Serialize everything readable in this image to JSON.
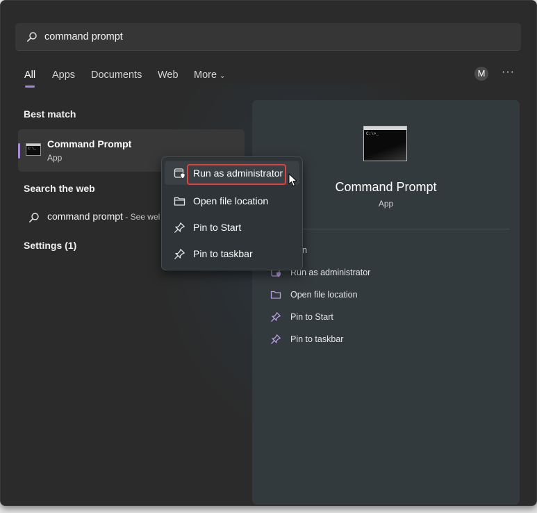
{
  "search": {
    "query": "command prompt"
  },
  "tabs": [
    {
      "label": "All",
      "active": true
    },
    {
      "label": "Apps"
    },
    {
      "label": "Documents"
    },
    {
      "label": "Web"
    },
    {
      "label": "More"
    }
  ],
  "header": {
    "avatar_initial": "M",
    "more_options": "···"
  },
  "sections": {
    "best_match": "Best match",
    "search_web": "Search the web",
    "settings": "Settings (1)"
  },
  "best_match_item": {
    "title": "Command Prompt",
    "subtitle": "App"
  },
  "web_result": {
    "query": "command prompt",
    "suffix": " - See wel"
  },
  "context_menu": {
    "items": [
      {
        "label": "Run as administrator",
        "icon": "shield-window-icon"
      },
      {
        "label": "Open file location",
        "icon": "folder-icon"
      },
      {
        "label": "Pin to Start",
        "icon": "pin-icon"
      },
      {
        "label": "Pin to taskbar",
        "icon": "pin-icon"
      }
    ]
  },
  "details": {
    "title": "Command Prompt",
    "subtitle": "App",
    "actions": [
      {
        "label": "en",
        "icon": "open-icon"
      },
      {
        "label": "Run as administrator",
        "icon": "shield-window-icon"
      },
      {
        "label": "Open file location",
        "icon": "folder-icon"
      },
      {
        "label": "Pin to Start",
        "icon": "pin-icon"
      },
      {
        "label": "Pin to taskbar",
        "icon": "pin-icon"
      }
    ]
  },
  "colors": {
    "accent": "#a987d9",
    "highlight": "#e0443e",
    "panel_bg": "#2b2b2b",
    "details_bg": "#333a3d"
  }
}
